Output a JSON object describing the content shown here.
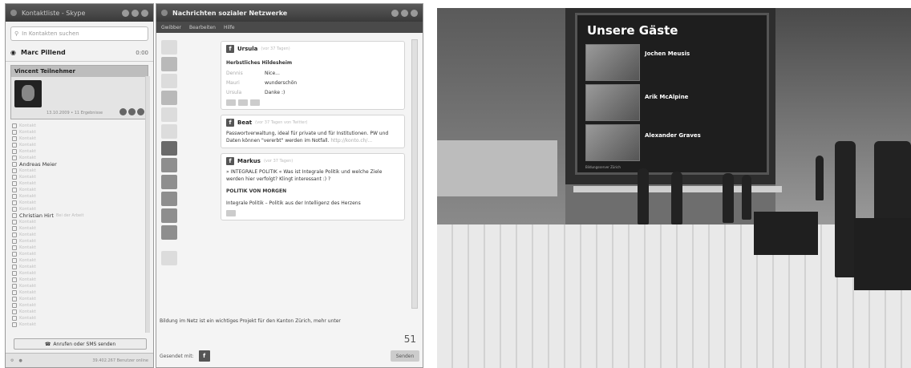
{
  "contacts_window": {
    "title": "Kontaktliste - Skype",
    "search_placeholder": "In Kontakten suchen",
    "user": {
      "name": "Marc Pillend",
      "time": "0:00"
    },
    "selected_contact": {
      "name": "Vincent Teilnehmer",
      "meta": "13.10.2009 • 11 Ergebnisse"
    },
    "list": [
      {
        "name": "Kontakt",
        "sub": ""
      },
      {
        "name": "Kontakt",
        "sub": ""
      },
      {
        "name": "Kontakt",
        "sub": ""
      },
      {
        "name": "Kontakt",
        "sub": ""
      },
      {
        "name": "Kontakt",
        "sub": ""
      },
      {
        "name": "Kontakt",
        "sub": ""
      },
      {
        "name": "Andreas Meier",
        "sub": "",
        "bold": true
      },
      {
        "name": "Kontakt",
        "sub": ""
      },
      {
        "name": "Kontakt",
        "sub": ""
      },
      {
        "name": "Kontakt",
        "sub": ""
      },
      {
        "name": "Kontakt",
        "sub": ""
      },
      {
        "name": "Kontakt",
        "sub": ""
      },
      {
        "name": "Kontakt",
        "sub": ""
      },
      {
        "name": "Kontakt",
        "sub": ""
      },
      {
        "name": "Christian Hirt",
        "sub": "Bei der Arbeit",
        "bold": true
      },
      {
        "name": "Kontakt",
        "sub": ""
      },
      {
        "name": "Kontakt",
        "sub": ""
      },
      {
        "name": "Kontakt",
        "sub": ""
      },
      {
        "name": "Kontakt",
        "sub": ""
      },
      {
        "name": "Kontakt",
        "sub": ""
      },
      {
        "name": "Kontakt",
        "sub": ""
      },
      {
        "name": "Kontakt",
        "sub": ""
      },
      {
        "name": "Kontakt",
        "sub": ""
      },
      {
        "name": "Kontakt",
        "sub": ""
      },
      {
        "name": "Kontakt",
        "sub": ""
      },
      {
        "name": "Kontakt",
        "sub": ""
      },
      {
        "name": "Kontakt",
        "sub": ""
      },
      {
        "name": "Kontakt",
        "sub": ""
      },
      {
        "name": "Kontakt",
        "sub": ""
      },
      {
        "name": "Kontakt",
        "sub": ""
      },
      {
        "name": "Kontakt",
        "sub": ""
      },
      {
        "name": "Kontakt",
        "sub": ""
      }
    ],
    "sms_button": "Anrufen oder SMS senden",
    "status_right": "39.402.267 Benutzer online"
  },
  "social_window": {
    "title": "Nachrichten sozialer Netzwerke",
    "menu": [
      "Gwibber",
      "Bearbeiten",
      "Hilfe"
    ],
    "posts": [
      {
        "author": "Ursula",
        "meta": "(vor 37 Tagen)",
        "body": "Herbstliches Hildesheim",
        "comments": [
          {
            "who": "Dennis",
            "what": "Nice..."
          },
          {
            "who": "Mauri",
            "what": "wunderschön"
          },
          {
            "who": "Ursula",
            "what": "Danke :)"
          }
        ]
      },
      {
        "author": "Beat",
        "meta": "(vor 37 Tagen von Twitter)",
        "body": "Passwortverwaltung, ideal für private und für Institutionen. PW und Daten können \"vererbt\" werden im Notfall.",
        "link": "http://konto.ch/...",
        "comments": []
      },
      {
        "author": "Markus",
        "meta": "(vor 37 Tagen)",
        "body": "» INTEGRALE POLITIK « Was ist Integrale Politik und welche Ziele werden hier verfolgt? Klingt interessant :) ?",
        "headline": "POLITIK VON MORGEN",
        "sub": "Integrale Politik – Politik aus der Intelligenz des Herzens",
        "comments": []
      }
    ],
    "compose_text": "Bildung im Netz ist ein wichtiges Projekt für den Kanton Zürich, mehr unter",
    "counter": "51",
    "send_label": "Gesendet mit:",
    "send_button": "Senden"
  },
  "scene": {
    "screen_title": "Unsere Gäste",
    "guests": [
      {
        "name": "Jochen Meusis",
        "desc": ""
      },
      {
        "name": "Arik McAlpine",
        "desc": ""
      },
      {
        "name": "Alexander Graves",
        "desc": ""
      }
    ],
    "footer_left": "Bildungsserver Zürich",
    "footer_right": ""
  }
}
